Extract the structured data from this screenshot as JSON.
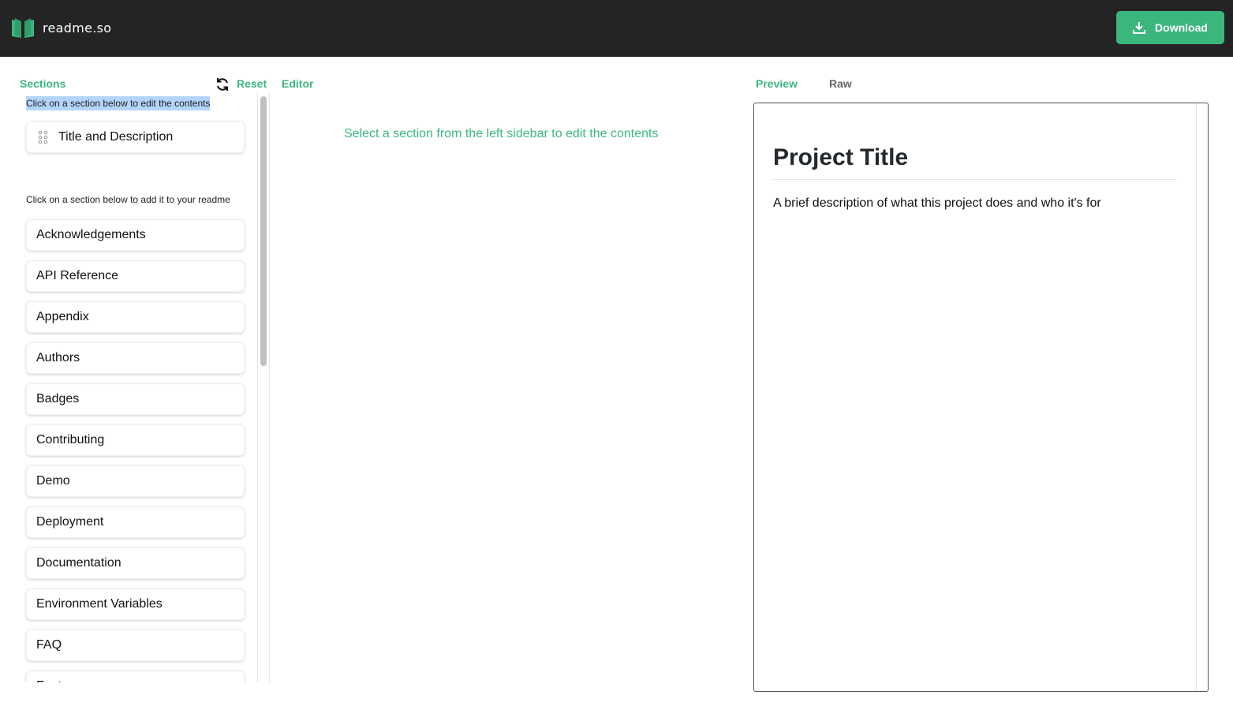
{
  "header": {
    "app_name": "readme.so",
    "download_label": "Download"
  },
  "sidebar": {
    "title": "Sections",
    "reset_label": "Reset",
    "selected_hint": "Click on a section below to edit the contents",
    "selected_sections": [
      "Title and Description"
    ],
    "add_hint": "Click on a section below to add it to your readme",
    "available_sections": [
      "Acknowledgements",
      "API Reference",
      "Appendix",
      "Authors",
      "Badges",
      "Contributing",
      "Demo",
      "Deployment",
      "Documentation",
      "Environment Variables",
      "FAQ",
      "Features"
    ]
  },
  "editor": {
    "title": "Editor",
    "empty_message": "Select a section from the left sidebar to edit the contents"
  },
  "preview": {
    "tabs": [
      "Preview",
      "Raw"
    ],
    "heading": "Project Title",
    "description": "A brief description of what this project does and who it's for"
  },
  "colors": {
    "accent": "#3bb77e",
    "header_bg": "#242424"
  }
}
